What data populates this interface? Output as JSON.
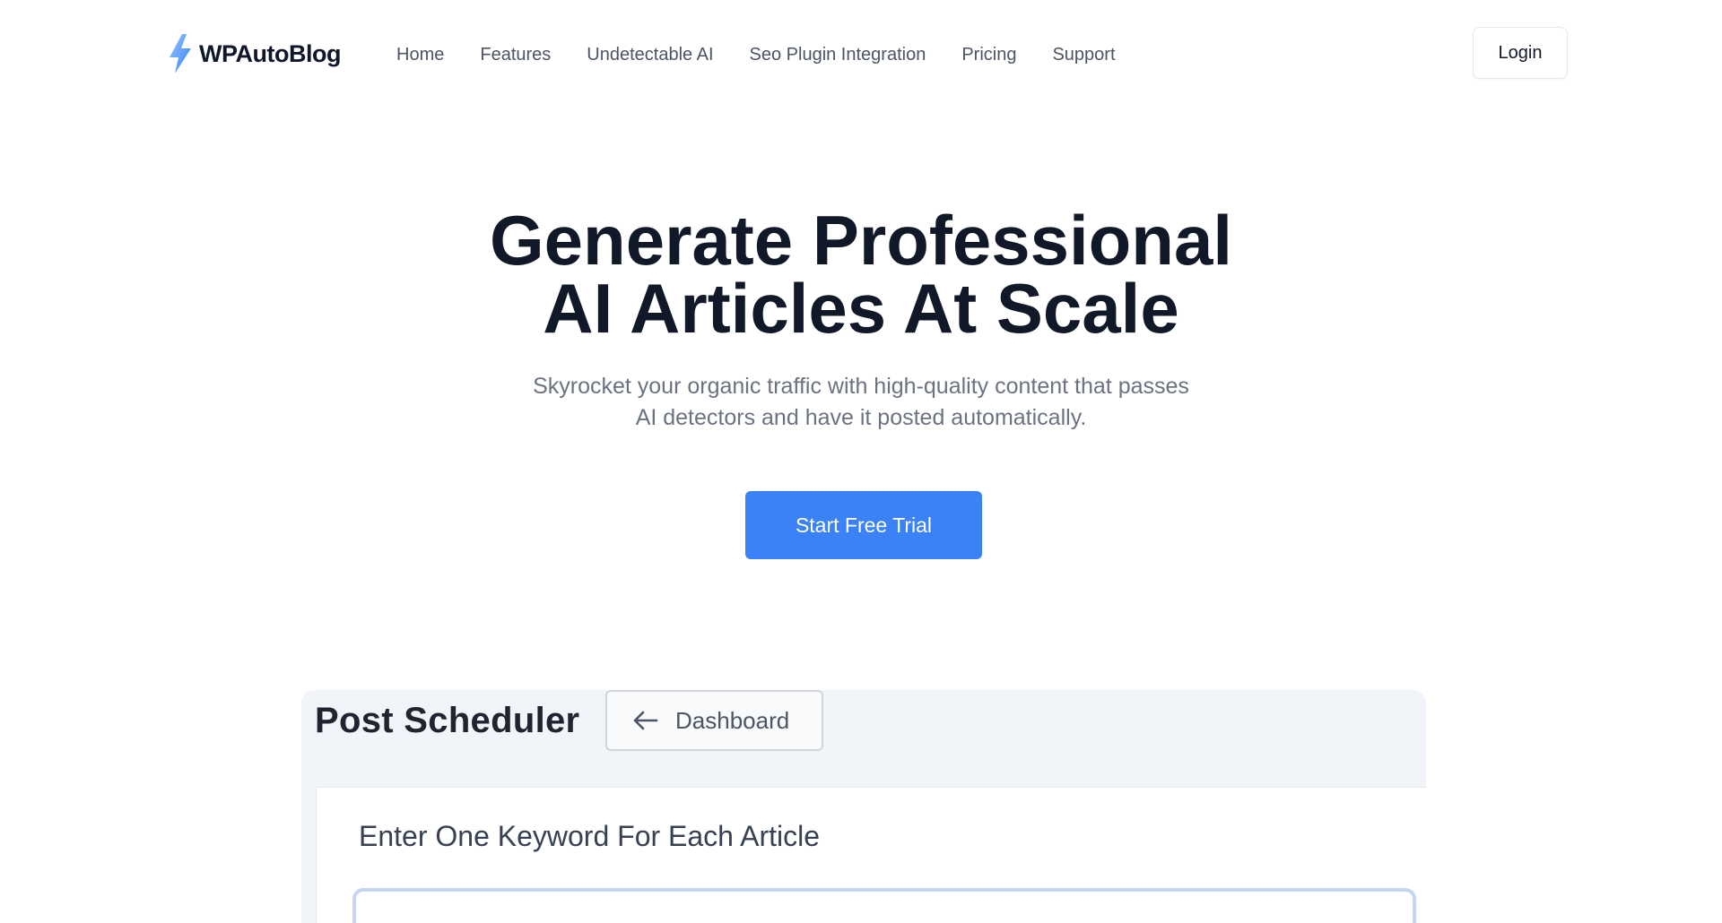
{
  "brand": {
    "name": "WPAutoBlog",
    "icon": "lightning-bolt-icon",
    "icon_color": "#60a5fa"
  },
  "nav": {
    "items": [
      {
        "label": "Home"
      },
      {
        "label": "Features"
      },
      {
        "label": "Undetectable AI"
      },
      {
        "label": "Seo Plugin Integration"
      },
      {
        "label": "Pricing"
      },
      {
        "label": "Support"
      }
    ],
    "login_label": "Login"
  },
  "hero": {
    "title_line1": "Generate Professional",
    "title_line2": "AI Articles At Scale",
    "subtitle": "Skyrocket your organic traffic with high-quality content that passes AI detectors and have it posted automatically.",
    "cta_label": "Start Free Trial",
    "cta_color": "#3b82f6"
  },
  "preview": {
    "title": "Post Scheduler",
    "back_button_label": "Dashboard",
    "back_icon": "arrow-left-icon",
    "card_label": "Enter One Keyword For Each Article",
    "keyword_input_value": ""
  }
}
